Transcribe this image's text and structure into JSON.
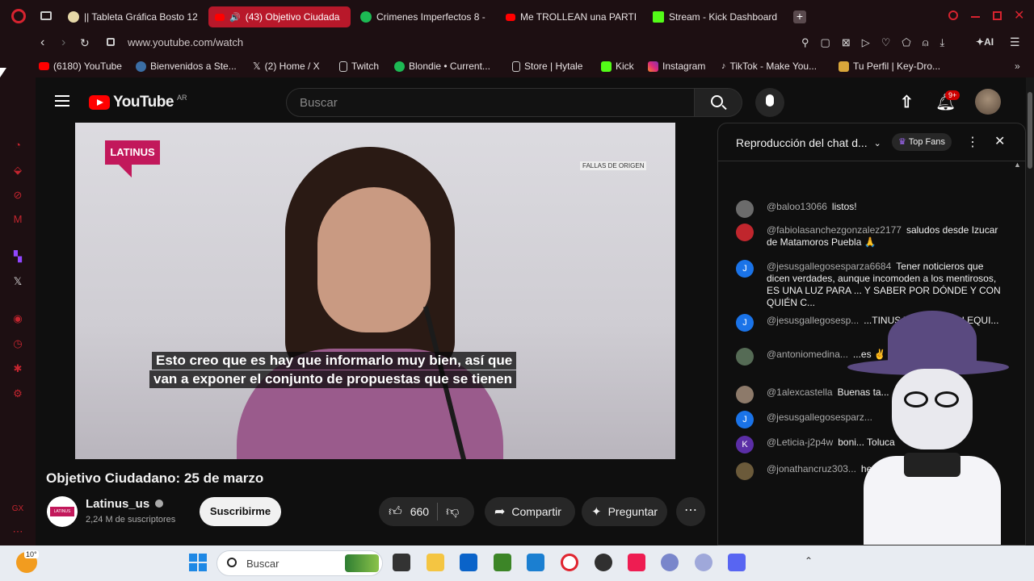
{
  "browser": {
    "tabs": [
      {
        "label": "|| Tableta Gráfica Bosto 12",
        "active": false
      },
      {
        "label": "(43) Objetivo Ciudada",
        "active": true
      },
      {
        "label": "Crimenes Imperfectos 8 -",
        "active": false
      },
      {
        "label": "Me TROLLEAN una PARTI",
        "active": false
      },
      {
        "label": "Stream - Kick Dashboard",
        "active": false
      }
    ],
    "url": "www.youtube.com/watch",
    "ai_label": "AI",
    "bookmarks": [
      "(6180) YouTube",
      "Bienvenidos a Ste...",
      "(2) Home / X",
      "Twitch",
      "Blondie • Current...",
      "Store | Hytale",
      "Kick",
      "Instagram",
      "TikTok - Make You...",
      "Tu Perfil | Key-Dro..."
    ],
    "sidebar_bottom": "GX"
  },
  "youtube": {
    "logo": "YouTube",
    "region": "AR",
    "search_placeholder": "Buscar",
    "notifications_badge": "9+",
    "video": {
      "channel_watermark": "LATINUS",
      "corner_label": "FALLAS DE ORIGEN",
      "subtitle_line1": "Esto creo que es hay que informarlo muy bien, así que",
      "subtitle_line2": "van a exponer el conjunto de propuestas que se tienen"
    },
    "title": "Objetivo Ciudadano: 25 de marzo",
    "channel": {
      "avatar_text": "LATINUS",
      "name": "Latinus_us",
      "subscribers": "2,24 M de suscriptores",
      "subscribe_label": "Suscribirme"
    },
    "actions": {
      "likes": "660",
      "share": "Compartir",
      "ask": "Preguntar"
    },
    "chat": {
      "header": "Reproducción del chat d...",
      "top_fans": "Top Fans",
      "messages": [
        {
          "author": "@baloo13066",
          "text": "listos!",
          "avatar": "",
          "color": "#6b6b6b"
        },
        {
          "author": "@fabiolasanchezgonzalez2177",
          "text": "saludos desde Izucar de Matamoros Puebla 🙏",
          "avatar": "",
          "color": "#c0262d"
        },
        {
          "author": "@jesusgallegosesparza6684",
          "text": "Tener noticieros que dicen verdades, aunque incomoden a los mentirosos, ES UNA LUZ PARA ... Y SABER POR DÓNDE Y CON QUIÉN C...",
          "avatar": "J",
          "color": "#1a73e8"
        },
        {
          "author": "@jesusgallegosesp...",
          "text": "...TINUS Y A TODO SU EQUI...",
          "avatar": "J",
          "color": "#1a73e8"
        },
        {
          "author": "@antoniomedina...",
          "text": "...es ✌",
          "avatar": "",
          "color": "#556b55"
        },
        {
          "author": "@1alexcastella",
          "text": "Buenas ta...",
          "avatar": "",
          "color": "#8d7a6a"
        },
        {
          "author": "@jesusgallegosesparz...",
          "text": "",
          "avatar": "J",
          "color": "#1a73e8"
        },
        {
          "author": "@Leticia-j2p4w",
          "text": "boni... Toluca",
          "avatar": "K",
          "color": "#5b2ea6"
        },
        {
          "author": "@jonathancruz303...",
          "text": "hermosa Cecilia",
          "avatar": "",
          "color": "#6b5a3a"
        }
      ]
    }
  },
  "taskbar": {
    "weather": "10°",
    "search": "Buscar"
  },
  "colors": {
    "browser_accent": "#b8182a",
    "youtube_red": "#ff0000",
    "latinus_pink": "#c2185b"
  }
}
